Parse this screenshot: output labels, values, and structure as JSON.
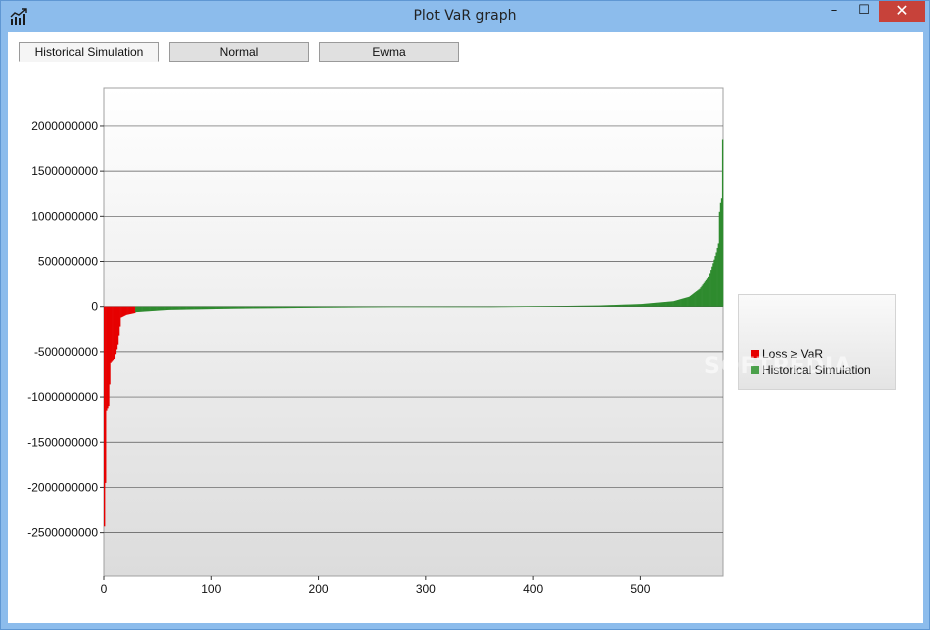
{
  "window": {
    "title": "Plot VaR graph",
    "minimize_glyph": "–",
    "maximize_glyph": "☐",
    "close_glyph": "✕"
  },
  "tabs": [
    {
      "label": "Historical Simulation",
      "active": true
    },
    {
      "label": "Normal",
      "active": false
    },
    {
      "label": "Ewma",
      "active": false
    }
  ],
  "legend": {
    "items": [
      {
        "label": "Loss ≥ VaR",
        "color": "#e60000"
      },
      {
        "label": "Historical Simulation",
        "color": "#4aa04a"
      }
    ]
  },
  "watermark": "SOFTPEDIA",
  "colors": {
    "loss": "#e60000",
    "simulation": "#2e8b2e",
    "gridline": "#555555",
    "plot_top": "#ffffff",
    "plot_bottom": "#dcdcdc"
  },
  "chart_data": {
    "type": "bar",
    "title": "",
    "xlabel": "",
    "ylabel": "",
    "xlim": [
      0,
      577
    ],
    "ylim": [
      -2980000000,
      2420000000
    ],
    "xticks": [
      0,
      100,
      200,
      300,
      400,
      500
    ],
    "yticks": [
      2000000000,
      1500000000,
      1000000000,
      500000000,
      0,
      -500000000,
      -1000000000,
      -1500000000,
      -2000000000,
      -2500000000
    ],
    "ytick_labels": [
      "2000000000",
      "1500000000",
      "1000000000",
      "500000000",
      "0",
      "-500000000",
      "-1000000000",
      "-1500000000",
      "-2000000000",
      "-2500000000"
    ],
    "grid": "horizontal",
    "legend_position": "right",
    "var_cutoff_index": 29,
    "series_note_points": [
      [
        0,
        -2430000000
      ],
      [
        1,
        -1950000000
      ],
      [
        2,
        -1150000000
      ],
      [
        4,
        -1100000000
      ],
      [
        6,
        -620000000
      ],
      [
        9,
        -580000000
      ],
      [
        12,
        -420000000
      ],
      [
        15,
        -120000000
      ],
      [
        20,
        -90000000
      ],
      [
        28,
        -70000000
      ],
      [
        29,
        -60000000
      ],
      [
        60,
        -35000000
      ],
      [
        120,
        -22000000
      ],
      [
        200,
        -12000000
      ],
      [
        300,
        -4000000
      ],
      [
        360,
        0
      ],
      [
        420,
        6000000
      ],
      [
        460,
        12000000
      ],
      [
        500,
        28000000
      ],
      [
        530,
        60000000
      ],
      [
        545,
        110000000
      ],
      [
        555,
        200000000
      ],
      [
        563,
        330000000
      ],
      [
        567,
        480000000
      ],
      [
        570,
        600000000
      ],
      [
        572,
        700000000
      ],
      [
        573,
        1050000000
      ],
      [
        574,
        1150000000
      ],
      [
        575,
        1200000000
      ],
      [
        576,
        1850000000
      ]
    ],
    "n_points": 577
  }
}
